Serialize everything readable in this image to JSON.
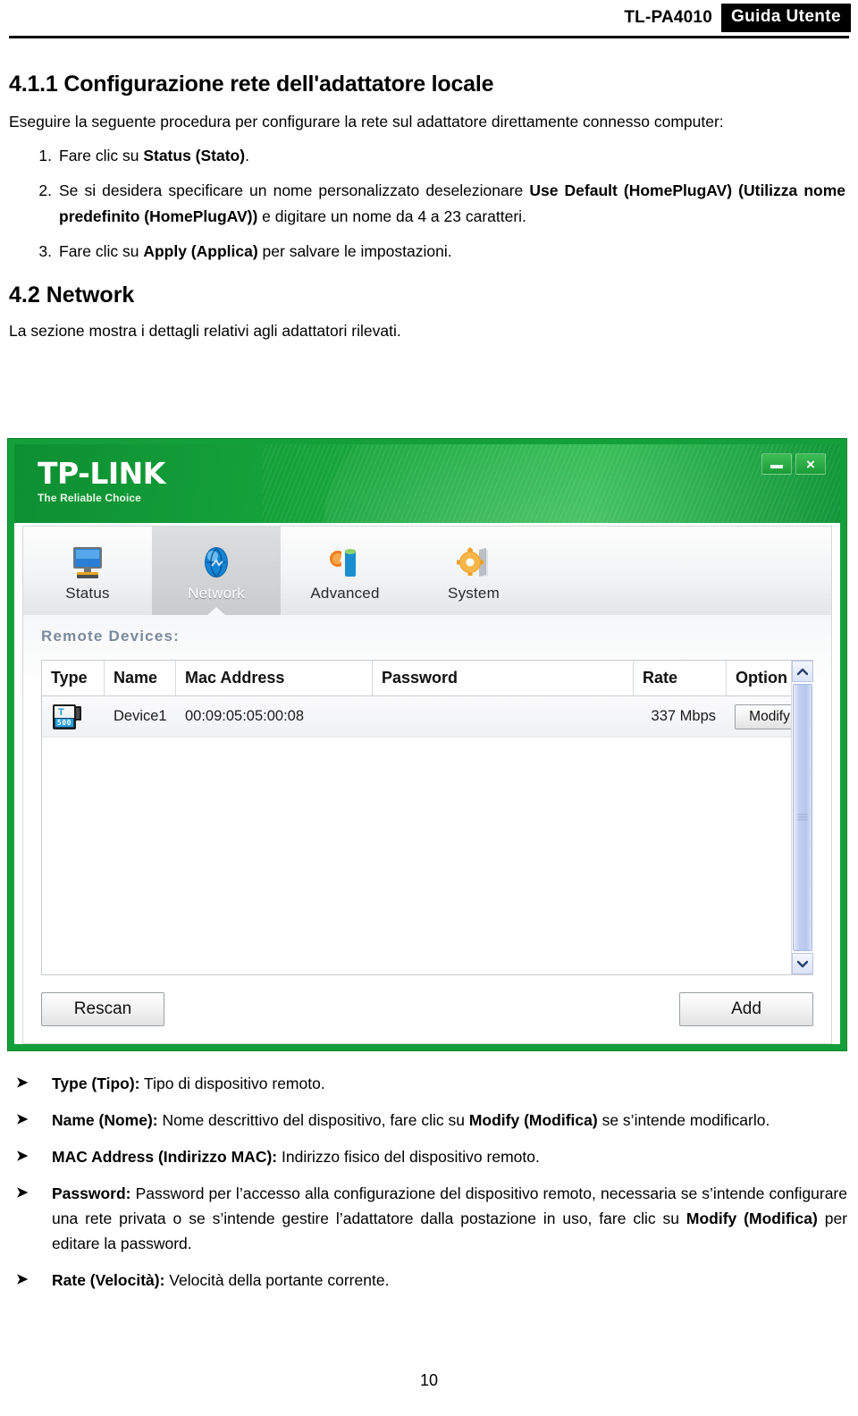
{
  "header": {
    "model": "TL-PA4010",
    "guide": "Guida Utente"
  },
  "doc": {
    "section_4_1_1_title": "4.1.1 Configurazione rete dell'adattatore locale",
    "intro": "Eseguire la seguente procedura per configurare la rete sul adattatore direttamente connesso computer:",
    "steps": [
      {
        "num": "1.",
        "html": "Fare clic su <b>Status (Stato)</b>."
      },
      {
        "num": "2.",
        "html": "Se si desidera specificare un nome personalizzato deselezionare <b>Use Default (HomePlugAV) (Utilizza nome predefinito (HomePlugAV))</b> e digitare un nome da 4 a 23 caratteri."
      },
      {
        "num": "3.",
        "html": "Fare clic su <b>Apply (Applica)</b> per salvare le impostazioni."
      }
    ],
    "section_4_2_title": "4.2 Network",
    "section_4_2_intro": "La sezione mostra i dettagli relativi agli adattatori rilevati.",
    "bullets": [
      {
        "marker": "➤",
        "html": "<b>Type (Tipo):</b> Tipo di dispositivo remoto."
      },
      {
        "marker": "➤",
        "html": "<b>Name (Nome):</b> Nome descrittivo del dispositivo, fare clic su <b>Modify (Modifica)</b> se s’intende modificarlo."
      },
      {
        "marker": "➤",
        "html": "<b>MAC Address (Indirizzo MAC):</b> Indirizzo fisico del dispositivo remoto."
      },
      {
        "marker": "➤",
        "html": "<b>Password:</b> Password per l’accesso alla configurazione del dispositivo remoto, necessaria se s’intende configurare una rete privata o se s’intende gestire l’adattatore dalla postazione in uso, fare clic su <b>Modify (Modifica)</b> per editare la password."
      },
      {
        "marker": "➤",
        "html": "<b>Rate (Velocità):</b> Velocità della portante corrente."
      }
    ],
    "page_number": "10"
  },
  "app": {
    "brand": "TP-LINK",
    "tagline": "The Reliable Choice",
    "window_controls": {
      "minimize": "minimize-icon",
      "close": "×"
    },
    "tabs": [
      {
        "label": "Status",
        "icon": "monitor-icon",
        "active": false
      },
      {
        "label": "Network",
        "icon": "globe-icon",
        "active": true
      },
      {
        "label": "Advanced",
        "icon": "tools-icon",
        "active": false
      },
      {
        "label": "System",
        "icon": "gear-icon",
        "active": false
      }
    ],
    "panel_label": "Remote Devices:",
    "table": {
      "columns": [
        "Type",
        "Name",
        "Mac Address",
        "Password",
        "Rate",
        "Option"
      ],
      "rows": [
        {
          "type_icon": "powerline-adapter-500-icon",
          "name": "Device1",
          "mac": "00:09:05:05:00:08",
          "password": "",
          "rate": "337 Mbps",
          "option": "Modify"
        }
      ]
    },
    "scrollbar": {
      "up": "▲",
      "down": "▼"
    },
    "buttons": {
      "rescan": "Rescan",
      "add": "Add"
    },
    "colors": {
      "brand_green": "#13a03a",
      "panel_label": "#7b8a9c",
      "scroll_thumb": "#b8c6ef"
    }
  }
}
